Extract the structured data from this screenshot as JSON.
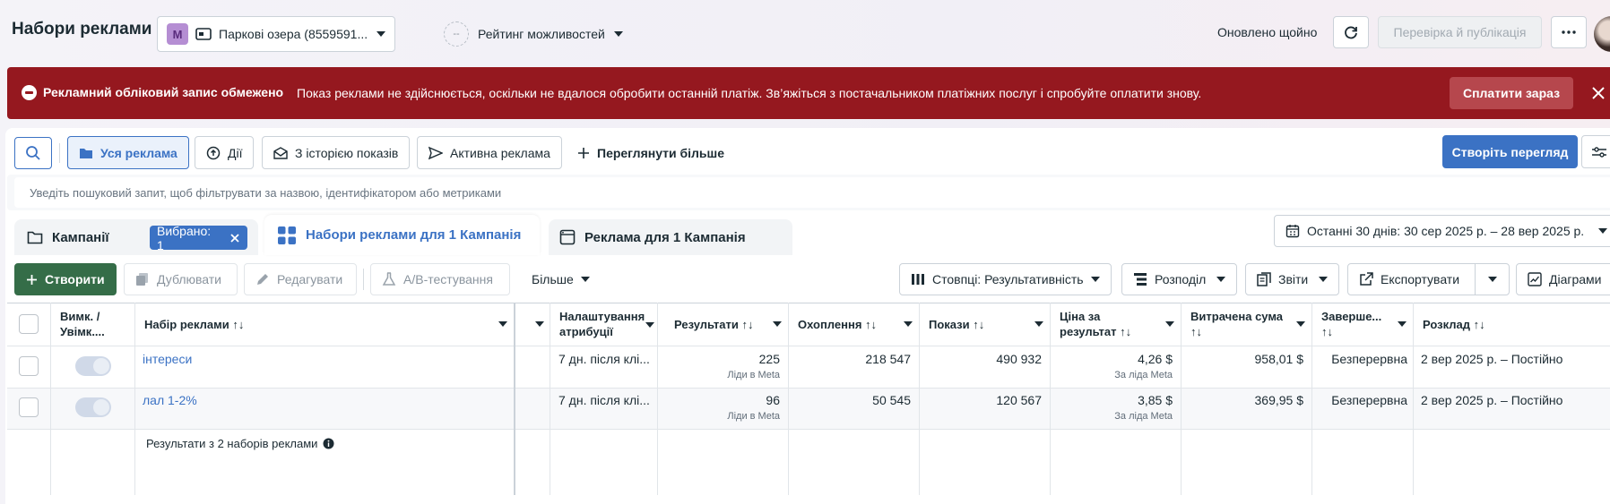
{
  "header": {
    "title": "Набори реклами",
    "account_badge": "M",
    "account_name": "Паркові озера (8559591...",
    "opportunity_score_value": "--",
    "opportunity_label": "Рейтинг можливостей",
    "updated_text": "Оновлено щойно",
    "review_publish_label": "Перевірка й публікація"
  },
  "banner": {
    "title": "Рекламний обліковий запис обмежено",
    "text": "Показ реклами не здійснюється, оскільки не вдалося обробити останній платіж. Зв’яжіться з постачальником платіжних послуг і спробуйте оплатити знову.",
    "pay_label": "Сплатити зараз"
  },
  "filters": {
    "chips": [
      "Уся реклама",
      "Дії",
      "З історією показів",
      "Активна реклама",
      "Переглянути більше"
    ],
    "create_view_label": "Створіть перегляд",
    "search_placeholder": "Уведіть пошуковий запит, щоб фільтрувати за назвою, ідентифікатором або метриками"
  },
  "levels": {
    "campaigns_label": "Кампанії",
    "selected_label": "Вибрано: 1",
    "adsets_label": "Набори реклами для 1 Кампанія",
    "ads_label": "Реклама для 1 Кампанія",
    "date_range": "Останні 30 днів: 30 сер 2025 р. – 28 вер 2025 р."
  },
  "toolbar": {
    "create": "Створити",
    "duplicate": "Дублювати",
    "edit": "Редагувати",
    "ab_test": "A/B-тестування",
    "more": "Більше",
    "columns": "Стовпці: Результативність",
    "breakdown": "Розподіл",
    "reports": "Звіти",
    "export": "Експортувати",
    "charts": "Діаграми"
  },
  "table": {
    "headers": {
      "toggle": "Вимк. / Увімк....",
      "name": "Набір реклами",
      "attribution": "Налаштування атрибуції",
      "results": "Результати",
      "reach": "Охоплення",
      "impressions": "Покази",
      "cost_per_result": "Ціна за результат",
      "spent": "Витрачена сума",
      "ends": "Заверше...",
      "schedule": "Розклад"
    },
    "sort_glyph": "↑↓",
    "rows": [
      {
        "name": "інтереси",
        "attribution": "7 дн. після клі...",
        "results": "225",
        "results_sub": "Ліди в Meta",
        "reach": "218 547",
        "impressions": "490 932",
        "cost_per_result": "4,26 $",
        "cost_sub": "За ліда Meta",
        "spent": "958,01 $",
        "ends": "Безперервна",
        "schedule": "2 вер 2025 р. – Постійно"
      },
      {
        "name": "лал 1-2%",
        "attribution": "7 дн. після клі...",
        "results": "96",
        "results_sub": "Ліди в Meta",
        "reach": "50 545",
        "impressions": "120 567",
        "cost_per_result": "3,85 $",
        "cost_sub": "За ліда Meta",
        "spent": "369,95 $",
        "ends": "Безперервна",
        "schedule": "2 вер 2025 р. – Постійно"
      }
    ],
    "footer_text": "Результати з 2 наборів реклами"
  },
  "colors": {
    "banner": "#95181f",
    "accent_blue": "#3b72c4",
    "create_green": "#356d48"
  }
}
